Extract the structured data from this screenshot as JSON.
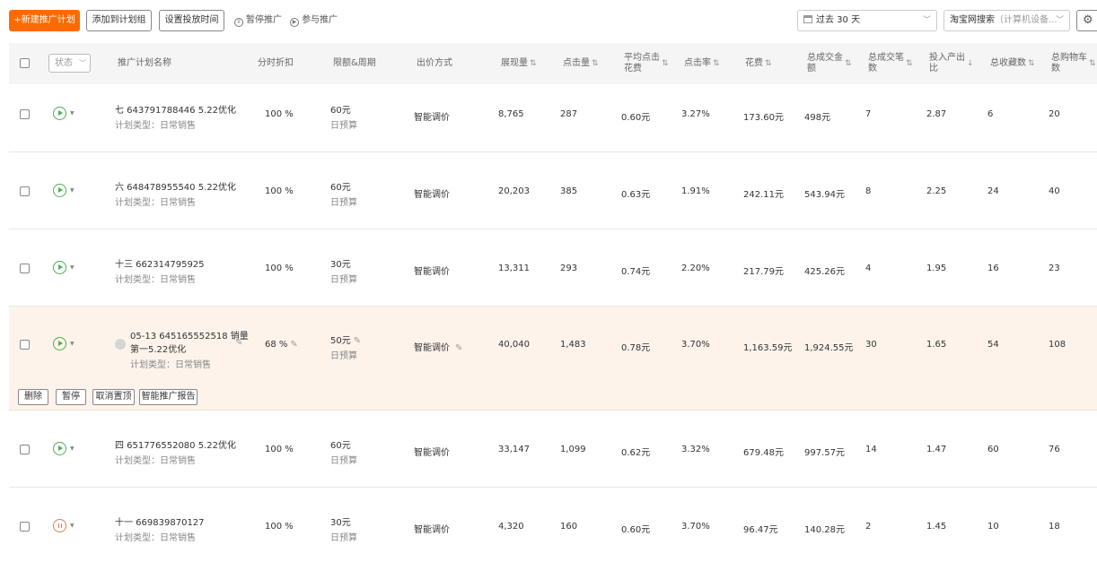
{
  "toolbar": {
    "new_plan": "+新建推广计划",
    "add_to_group": "添加到计划组",
    "set_time": "设置投放时间",
    "pause": "暂停推广",
    "join": "参与推广",
    "date_range": "过去 30 天",
    "channel": "淘宝网搜索",
    "device": "（计算机设备...",
    "gear_icon": "gear-icon"
  },
  "header": {
    "status": "状态",
    "name": "推广计划名称",
    "discount": "分时折扣",
    "budget": "限额&周期",
    "bid": "出价方式",
    "impressions": "展现量",
    "clicks": "点击量",
    "avg_cost_1": "平均点击",
    "avg_cost_2": "花费",
    "ctr": "点击率",
    "cost": "花费",
    "gmv_1": "总成交金",
    "gmv_2": "额",
    "orders_1": "总成交笔",
    "orders_2": "数",
    "roi_1": "投入产出",
    "roi_2": "比",
    "favs": "总收藏数",
    "cart_1": "总购物车",
    "cart_2": "数"
  },
  "rows": [
    {
      "name": "七 643791788446 5.22优化",
      "type": "计划类型：日常销售",
      "discount": "100 %",
      "budget": "60元",
      "period": "日预算",
      "bid": "智能调价",
      "impressions": "8,765",
      "clicks": "287",
      "avg_cost": "0.60元",
      "ctr": "3.27%",
      "cost": "173.60元",
      "gmv": "498元",
      "orders": "7",
      "roi": "2.87",
      "favs": "6",
      "cart": "20",
      "status": "running"
    },
    {
      "name": "六 648478955540 5.22优化",
      "type": "计划类型：日常销售",
      "discount": "100 %",
      "budget": "60元",
      "period": "日预算",
      "bid": "智能调价",
      "impressions": "20,203",
      "clicks": "385",
      "avg_cost": "0.63元",
      "ctr": "1.91%",
      "cost": "242.11元",
      "gmv": "543.94元",
      "orders": "8",
      "roi": "2.25",
      "favs": "24",
      "cart": "40",
      "status": "running"
    },
    {
      "name": "十三 662314795925",
      "type": "计划类型：日常销售",
      "discount": "100 %",
      "budget": "30元",
      "period": "日预算",
      "bid": "智能调价",
      "impressions": "13,311",
      "clicks": "293",
      "avg_cost": "0.74元",
      "ctr": "2.20%",
      "cost": "217.79元",
      "gmv": "425.26元",
      "orders": "4",
      "roi": "1.95",
      "favs": "16",
      "cart": "23",
      "status": "running"
    },
    {
      "name_1": "05-13 645165552518 销量",
      "name_2": "第一5.22优化",
      "type": "计划类型：日常销售",
      "discount": "68 %",
      "budget": "50元",
      "period": "日预算",
      "bid": "智能调价",
      "impressions": "40,040",
      "clicks": "1,483",
      "avg_cost": "0.78元",
      "ctr": "3.70%",
      "cost": "1,163.59元",
      "gmv": "1,924.55元",
      "orders": "30",
      "roi": "1.65",
      "favs": "54",
      "cart": "108",
      "status": "running"
    },
    {
      "name": "四 651776552080 5.22优化",
      "type": "计划类型：日常销售",
      "discount": "100 %",
      "budget": "60元",
      "period": "日预算",
      "bid": "智能调价",
      "impressions": "33,147",
      "clicks": "1,099",
      "avg_cost": "0.62元",
      "ctr": "3.32%",
      "cost": "679.48元",
      "gmv": "997.57元",
      "orders": "14",
      "roi": "1.47",
      "favs": "60",
      "cart": "76",
      "status": "running"
    },
    {
      "name": "十一 669839870127",
      "type": "计划类型：日常销售",
      "discount": "100 %",
      "budget": "30元",
      "period": "日预算",
      "bid": "智能调价",
      "impressions": "4,320",
      "clicks": "160",
      "avg_cost": "0.60元",
      "ctr": "3.70%",
      "cost": "96.47元",
      "gmv": "140.28元",
      "orders": "2",
      "roi": "1.45",
      "favs": "10",
      "cart": "18",
      "status": "paused"
    }
  ],
  "row_actions": {
    "delete": "删除",
    "pause": "暂停",
    "unpin": "取消置顶",
    "report": "智能推广报告"
  },
  "colors": {
    "accent": "#ff6a00",
    "running": "#4caf50",
    "paused": "#e57a55",
    "highlight": "#fdf3eb"
  }
}
